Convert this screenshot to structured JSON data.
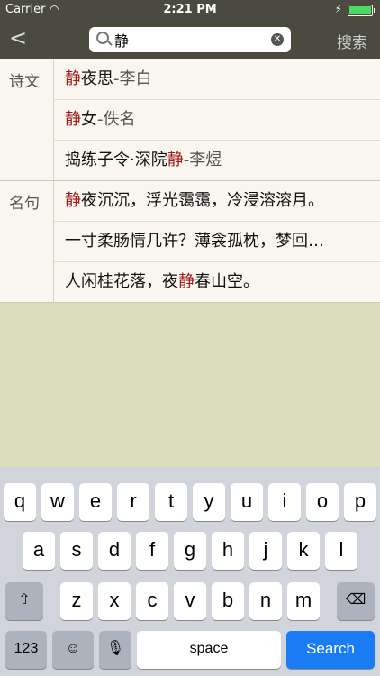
{
  "status_bar": {
    "carrier": "Carrier",
    "time": "2:21 PM"
  },
  "nav": {
    "back_label": "<",
    "search_value": "静",
    "search_button": "搜索"
  },
  "sections": [
    {
      "label": "诗文",
      "rows": [
        {
          "hl": "静",
          "rest": "夜思",
          "suffix": "-李白"
        },
        {
          "hl": "静",
          "rest": "女",
          "suffix": "-佚名"
        },
        {
          "pre": "捣练子令·深院",
          "hl": "静",
          "suffix": "-李煜"
        }
      ]
    },
    {
      "label": "名句",
      "rows": [
        {
          "hl": "静",
          "rest": "夜沉沉，浮光霭霭，冷浸溶溶月。"
        },
        {
          "rest": "一寸柔肠情几许？薄衾孤枕，梦回…"
        },
        {
          "pre": "人闲桂花落，夜",
          "hl": "静",
          "rest": "春山空。"
        }
      ]
    }
  ],
  "keyboard": {
    "row1": [
      "q",
      "w",
      "e",
      "r",
      "t",
      "y",
      "u",
      "i",
      "o",
      "p"
    ],
    "row2": [
      "a",
      "s",
      "d",
      "f",
      "g",
      "h",
      "j",
      "k",
      "l"
    ],
    "row3": [
      "z",
      "x",
      "c",
      "v",
      "b",
      "n",
      "m"
    ],
    "numbers_key": "123",
    "space_key": "space",
    "search_key": "Search"
  }
}
